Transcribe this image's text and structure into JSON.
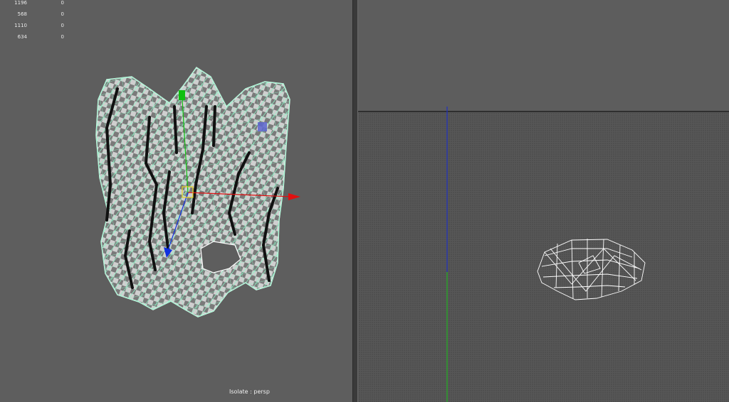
{
  "stats": [
    {
      "value": "1196",
      "secondary": "0"
    },
    {
      "value": "568",
      "secondary": "0"
    },
    {
      "value": "1110",
      "secondary": "0"
    },
    {
      "value": "634",
      "secondary": "0"
    }
  ],
  "viewport": {
    "isolate_label": "Isolate : persp"
  },
  "colors": {
    "viewport_bg": "#5e5e5e",
    "wireframe": "#7ff0c0",
    "axis_x": "#e01010",
    "axis_y": "#10c010",
    "axis_z": "#1010e0",
    "grid_bg": "#4f4f4f"
  }
}
